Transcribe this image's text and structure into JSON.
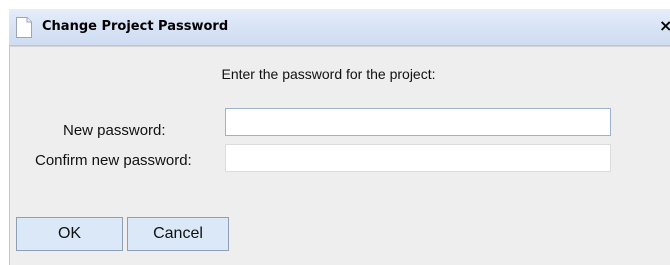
{
  "window": {
    "title": "Change Project Password",
    "title_icon": "document-icon",
    "close_label": "×"
  },
  "form": {
    "instruction": "Enter the password for the project:",
    "new_password_label": "New password:",
    "new_password_value": "",
    "confirm_password_label": "Confirm new password:",
    "confirm_password_value": ""
  },
  "buttons": {
    "ok_label": "OK",
    "cancel_label": "Cancel"
  },
  "colors": {
    "dialog_background": "#eeeeee",
    "titlebar": "#d9e4f6",
    "button_background": "#dbe8f7"
  }
}
